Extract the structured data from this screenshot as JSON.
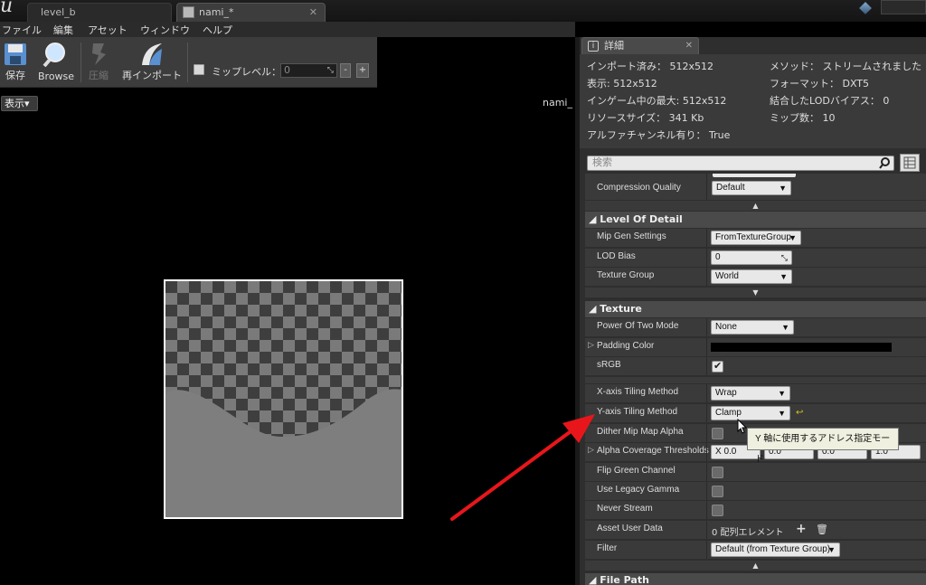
{
  "tabs": [
    {
      "label": "level_b"
    },
    {
      "label": "nami_*"
    }
  ],
  "menu": [
    "ファイル",
    "編集",
    "アセット",
    "ウィンドウ",
    "ヘルプ"
  ],
  "toolbar": {
    "save": "保存",
    "browse": "Browse",
    "compress": "圧縮",
    "reimport": "再インポート",
    "mip_label": "ミップレベル：",
    "mip_value": "0",
    "minus": "-",
    "plus": "+"
  },
  "viewport": {
    "show_label": "表示▾",
    "texture_name": "nami_"
  },
  "details": {
    "tab_label": "詳細",
    "info_left": [
      "インポート済み： 512x512",
      "表示: 512x512",
      "インゲーム中の最大: 512x512",
      "リソースサイズ： 341 Kb",
      "アルファチャンネル有り： True"
    ],
    "info_right": [
      "メソッド： ストリームされました",
      "フォーマット： DXT5",
      "結合したLODバイアス： 0",
      "ミップ数： 10"
    ],
    "search_placeholder": "検索",
    "compression_quality": {
      "name": "Compression Quality",
      "value": "Default"
    },
    "lod_category": "Level Of Detail",
    "mip_gen": {
      "name": "Mip Gen Settings",
      "value": "FromTextureGroup"
    },
    "lod_bias": {
      "name": "LOD Bias",
      "value": "0"
    },
    "texture_group": {
      "name": "Texture Group",
      "value": "World"
    },
    "texture_category": "Texture",
    "power_of_two": {
      "name": "Power Of Two Mode",
      "value": "None"
    },
    "padding_color": {
      "name": "Padding Color"
    },
    "srgb": {
      "name": "sRGB",
      "checked": true
    },
    "x_tiling": {
      "name": "X-axis Tiling Method",
      "value": "Wrap"
    },
    "y_tiling": {
      "name": "Y-axis Tiling Method",
      "value": "Clamp"
    },
    "dither": {
      "name": "Dither Mip Map Alpha"
    },
    "alpha_coverage": {
      "name": "Alpha Coverage Thresholds",
      "x_label": "X",
      "x_value": "0.0",
      "y_value": "0.0",
      "z_value": "0.0",
      "w_value": "1.0"
    },
    "flip_green": {
      "name": "Flip Green Channel"
    },
    "legacy_gamma": {
      "name": "Use Legacy Gamma"
    },
    "never_stream": {
      "name": "Never Stream"
    },
    "asset_user_data": {
      "name": "Asset User Data",
      "value": "0 配列エレメント"
    },
    "filter": {
      "name": "Filter",
      "value": "Default (from Texture Group)"
    },
    "file_path_category": "File Path",
    "tooltip": "Y 軸に使用するアドレス指定モード"
  },
  "colors": {
    "accent_arrow": "#e8161b",
    "panel_bg": "#3a3a3a"
  }
}
